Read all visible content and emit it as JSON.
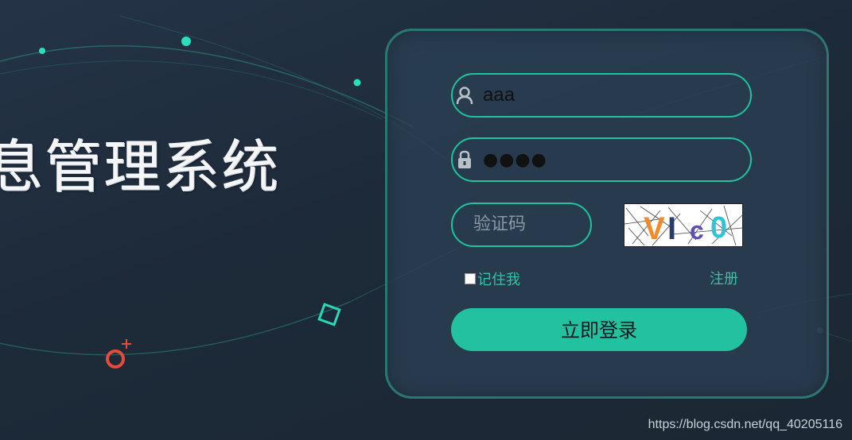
{
  "branding": {
    "system_title": "息管理系统",
    "watermark": "https://blog.csdn.net/qq_40205116"
  },
  "login": {
    "username": {
      "value": "aaa",
      "icon": "user-icon"
    },
    "password": {
      "masked_value": "●●●●",
      "icon": "lock-icon"
    },
    "captcha": {
      "placeholder": "验证码",
      "image_text": "VI c0"
    },
    "remember_label": "记住我",
    "register_label": "注册",
    "submit_label": "立即登录"
  },
  "colors": {
    "accent": "#22c2a0",
    "background": "#1f2c3c",
    "card": "#2c4054",
    "link": "#33c3a6"
  }
}
